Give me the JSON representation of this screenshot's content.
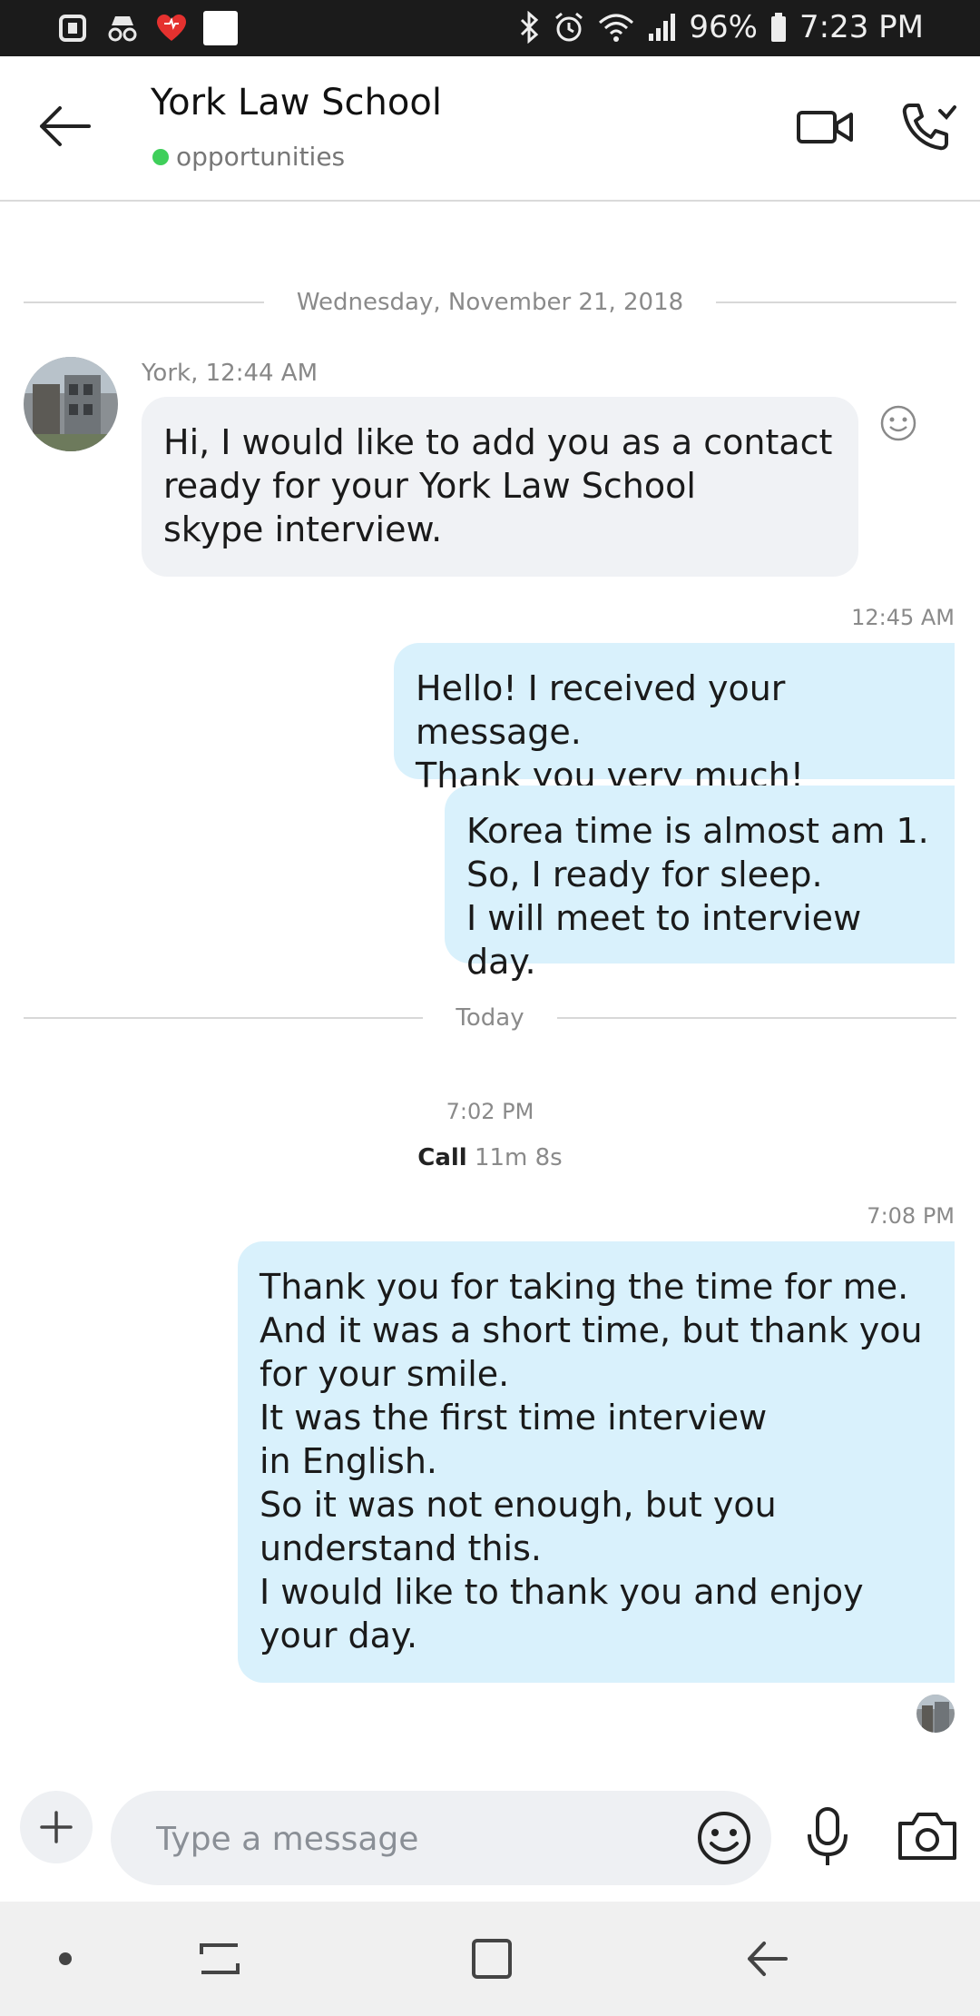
{
  "status_bar": {
    "battery": "96%",
    "time": "7:23 PM"
  },
  "header": {
    "title": "York Law School",
    "subtitle": "opportunities"
  },
  "date_separator_1": "Wednesday, November 21, 2018",
  "date_separator_2": "Today",
  "messages": {
    "incoming_1": {
      "sender_time": "York, 12:44 AM",
      "text": "Hi,  I would like to add you as a contact\nready for your York Law School\nskype interview."
    },
    "outgoing_1": {
      "time": "12:45 AM",
      "text": "Hello! I received your message.\nThank you very much!"
    },
    "outgoing_2": {
      "text": "Korea time is almost am 1.\nSo, I ready for sleep.\nI will meet to interview day."
    },
    "call": {
      "time": "7:02 PM",
      "label": "Call",
      "duration": "11m 8s"
    },
    "outgoing_3": {
      "time": "7:08 PM",
      "text": "Thank you for taking the time for me.\nAnd it was a short time, but thank you\nfor your smile.\nIt was the first time interview\nin English.\nSo it was not enough, but you\nunderstand this.\nI would like to thank you and enjoy\nyour day."
    }
  },
  "composer": {
    "placeholder": "Type a message"
  },
  "icons": {
    "back": "arrow-left-icon",
    "video": "video-camera-icon",
    "call": "phone-icon",
    "add": "plus-icon",
    "emoji": "smiley-icon",
    "mic": "microphone-icon",
    "camera": "camera-icon"
  },
  "colors": {
    "outgoing_bubble": "#d9f1fc",
    "incoming_bubble": "#f0f2f5",
    "presence": "#3fcf5a"
  }
}
